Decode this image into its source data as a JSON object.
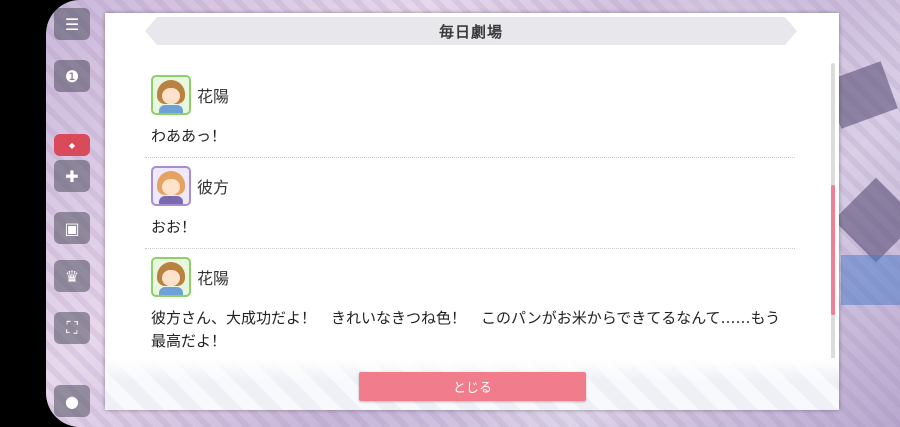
{
  "dialog": {
    "title": "毎日劇場",
    "close_label": "とじる"
  },
  "entries": [
    {
      "speaker": "花陽",
      "text": "わああっ！"
    },
    {
      "speaker": "彼方",
      "text": "おお！"
    },
    {
      "speaker": "花陽",
      "text": "彼方さん、大成功だよ！　きれいなきつね色！　このパンがお米からできてるなんて……もう最高だよ！"
    }
  ],
  "background": {
    "side_buttons": [
      {
        "icon": "menu-icon",
        "glyph": "☰"
      },
      {
        "icon": "chat-icon",
        "glyph": "❶"
      },
      {
        "icon": "gift-icon",
        "glyph": "🎁"
      },
      {
        "icon": "board-icon",
        "glyph": "▣"
      },
      {
        "icon": "trophy-icon",
        "glyph": "♛"
      },
      {
        "icon": "fullscreen-icon",
        "glyph": "⛶"
      }
    ]
  },
  "colors": {
    "accent": "#f07c8c",
    "scroll_thumb": "#ef7f95"
  }
}
